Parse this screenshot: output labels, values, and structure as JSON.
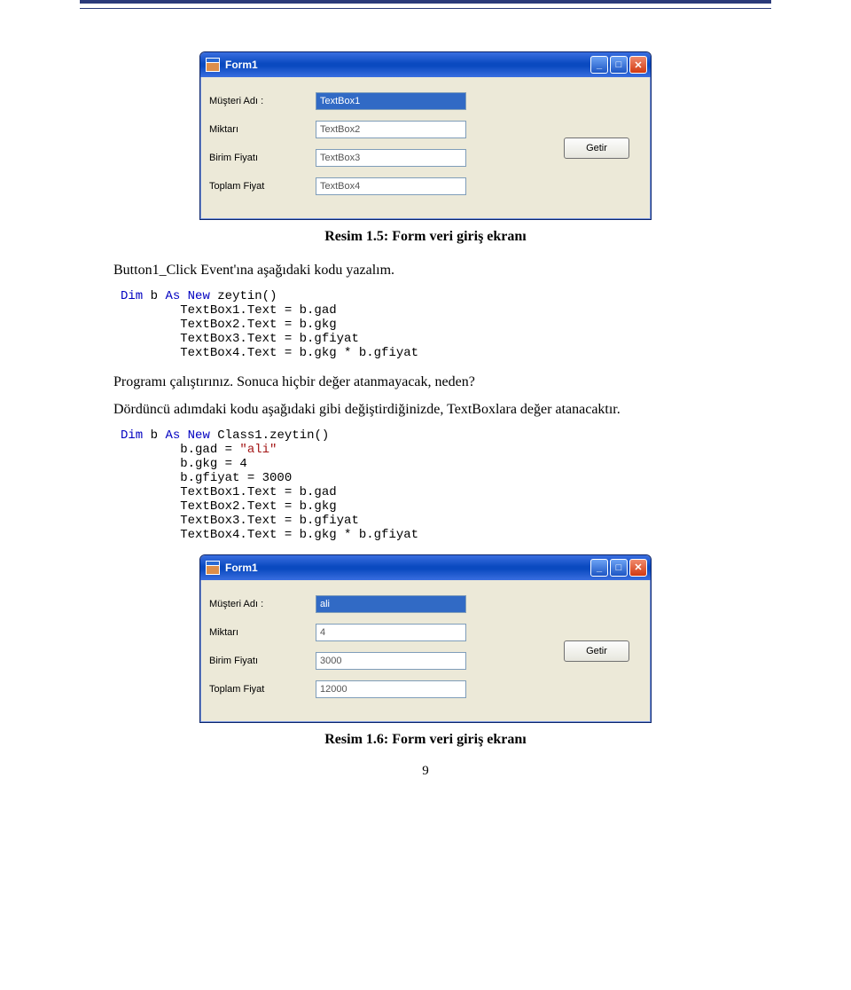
{
  "win1": {
    "title": "Form1",
    "rows": [
      {
        "label": "Müşteri Adı :",
        "value": "TextBox1",
        "selected": true
      },
      {
        "label": "Miktarı",
        "value": "TextBox2"
      },
      {
        "label": "Birim Fiyatı",
        "value": "TextBox3"
      },
      {
        "label": "Toplam Fiyat",
        "value": "TextBox4"
      }
    ],
    "button": "Getir"
  },
  "caption1": "Resim 1.5: Form veri giriş ekranı",
  "para1": "Button1_Click Event'ına aşağıdaki kodu yazalım.",
  "code1": {
    "kw1": "Dim",
    "mid1": " b ",
    "kw2": "As",
    "mid2": " ",
    "kw3": "New",
    "tail": " zeytin()",
    "l2": "        TextBox1.Text = b.gad",
    "l3": "        TextBox2.Text = b.gkg",
    "l4": "        TextBox3.Text = b.gfiyat",
    "l5": "        TextBox4.Text = b.gkg * b.gfiyat"
  },
  "para2": "Programı çalıştırınız. Sonuca hiçbir değer atanmayacak, neden?",
  "para3": "Dördüncü adımdaki kodu aşağıdaki gibi değiştirdiğinizde, TextBoxlara değer atanacaktır.",
  "code2": {
    "kw1": "Dim",
    "mid1": " b ",
    "kw2": "As",
    "mid2": " ",
    "kw3": "New",
    "tail": " Class1.zeytin()",
    "l2a": "        b.gad = ",
    "l2s": "\"ali\"",
    "l3": "        b.gkg = 4",
    "l4": "        b.gfiyat = 3000",
    "l5": "        TextBox1.Text = b.gad",
    "l6": "        TextBox2.Text = b.gkg",
    "l7": "        TextBox3.Text = b.gfiyat",
    "l8": "        TextBox4.Text = b.gkg * b.gfiyat"
  },
  "win2": {
    "title": "Form1",
    "rows": [
      {
        "label": "Müşteri Adı :",
        "value": "ali",
        "selected": true
      },
      {
        "label": "Miktarı",
        "value": "4"
      },
      {
        "label": "Birim Fiyatı",
        "value": "3000"
      },
      {
        "label": "Toplam Fiyat",
        "value": "12000"
      }
    ],
    "button": "Getir"
  },
  "caption2": "Resim 1.6: Form veri giriş ekranı",
  "pagenum": "9"
}
